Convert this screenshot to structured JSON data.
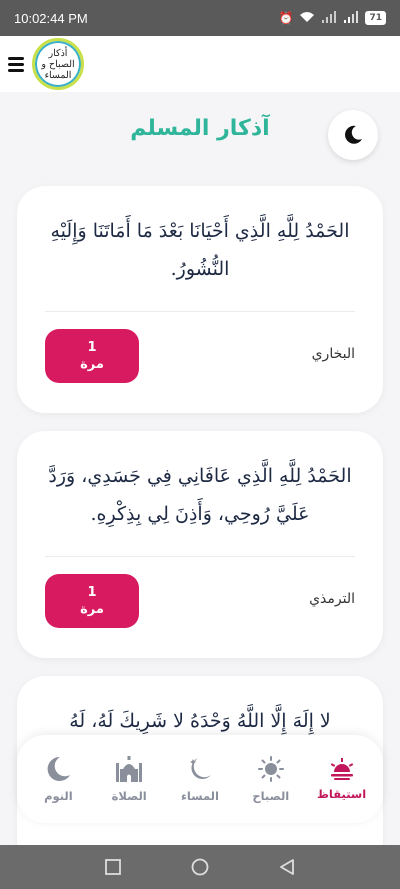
{
  "status_bar": {
    "time": "10:02:44 PM",
    "battery": "71",
    "icons": [
      "alarm-icon",
      "wifi-icon",
      "signal-icon",
      "battery-icon"
    ]
  },
  "header": {
    "logo_line1": "أذكار",
    "logo_line2": "الصباح و",
    "logo_line3": "المساء"
  },
  "title": "آذكار المسلم",
  "cards": [
    {
      "text": "الحَمْدُ لِلَّهِ الَّذِي أَحْيَانَا بَعْدَ مَا أَمَاتَنَا وَإِلَيْهِ النُّشُورُ.",
      "source": "البخاري",
      "count": "1",
      "count_unit": "مرة"
    },
    {
      "text": "الحَمْدُ لِلَّهِ الَّذِي عَافَانِي فِي جَسَدِي، وَرَدَّ عَلَيَّ رُوحِي، وَأَذِنَ لِي بِذِكْرِهِ.",
      "source": "الترمذي",
      "count": "1",
      "count_unit": "مرة"
    },
    {
      "text": "لا إِلَهَ إِلَّا اللَّهُ وَحْدَهُ لا شَرِيكَ لَهُ، لَهُ"
    }
  ],
  "bottom_nav": [
    {
      "label": "استيقاظ",
      "icon": "sunrise-icon",
      "active": true
    },
    {
      "label": "الصباح",
      "icon": "sun-icon",
      "active": false
    },
    {
      "label": "المساء",
      "icon": "moon-stars-icon",
      "active": false
    },
    {
      "label": "الصلاة",
      "icon": "mosque-icon",
      "active": false
    },
    {
      "label": "النوم",
      "icon": "crescent-icon",
      "active": false
    }
  ],
  "colors": {
    "accent": "#d81b60",
    "title": "#2fb59a",
    "nav_inactive": "#8a8f9c",
    "nav_active": "#c2185b"
  }
}
